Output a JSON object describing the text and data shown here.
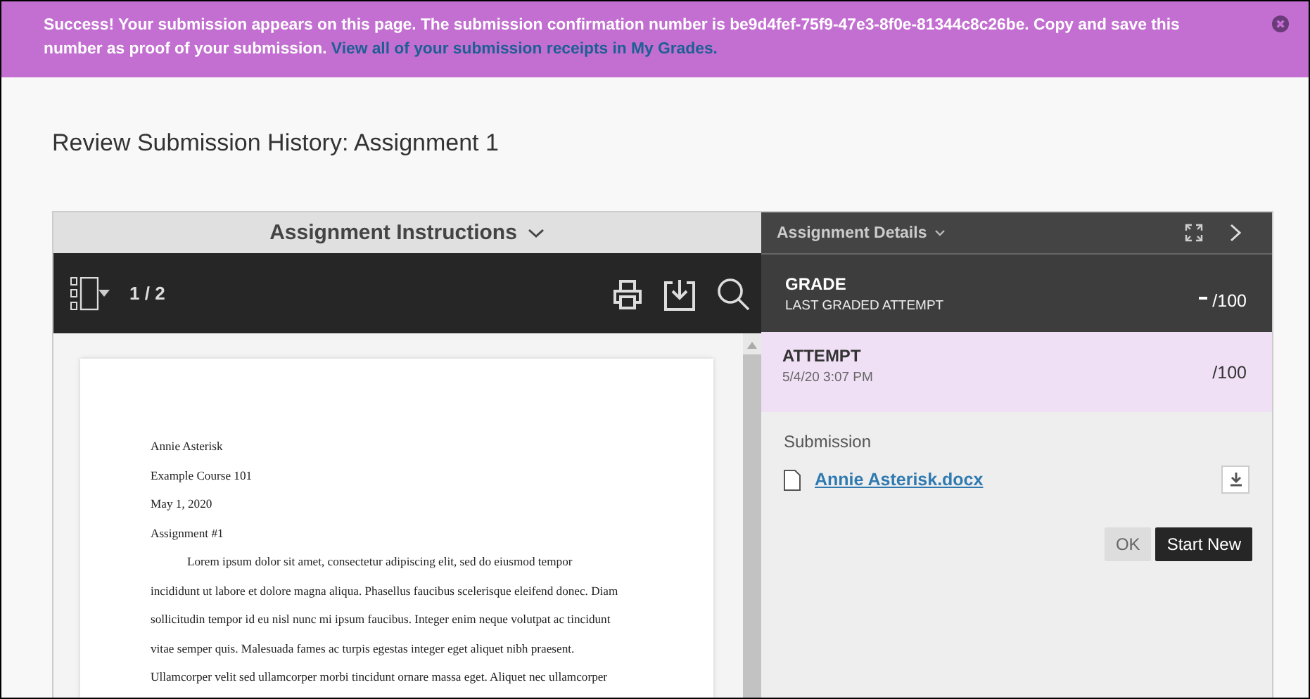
{
  "banner": {
    "text": "Success! Your submission appears on this page. The submission confirmation number is be9d4fef-75f9-47e3-8f0e-81344c8c26be. Copy and save this number as proof of your submission.",
    "link": "View all of your submission receipts in My Grades."
  },
  "page_title": "Review Submission History: Assignment 1",
  "instructions": {
    "title": "Assignment Instructions",
    "page": "1 / 2",
    "document": {
      "header_lines": [
        "Annie Asterisk",
        "Example Course 101",
        "May 1, 2020",
        "Assignment #1"
      ],
      "paragraph_lines": [
        "Lorem ipsum dolor sit amet, consectetur adipiscing elit, sed do eiusmod tempor",
        "incididunt ut labore et dolore magna aliqua. Phasellus faucibus scelerisque eleifend donec. Diam",
        "sollicitudin tempor id eu nisl nunc mi ipsum faucibus. Integer enim neque volutpat ac tincidunt",
        "vitae semper quis. Malesuada fames ac turpis egestas integer eget aliquet nibh praesent.",
        "Ullamcorper velit sed ullamcorper morbi tincidunt ornare massa eget. Aliquet nec ullamcorper"
      ]
    }
  },
  "details": {
    "title": "Assignment Details",
    "rows": [
      {
        "kind": "grade",
        "label": "GRADE",
        "sublabel": "LAST GRADED ATTEMPT",
        "score": "/100",
        "graded": false
      },
      {
        "kind": "attempt",
        "label": "ATTEMPT",
        "sublabel": "5/4/20 3:07 PM",
        "score": "/100",
        "selected": true
      }
    ],
    "submission_label": "Submission",
    "file": "Annie Asterisk.docx",
    "buttons": [
      {
        "kind": "secondary",
        "label": "OK"
      },
      {
        "kind": "primary",
        "label": "Start New"
      }
    ]
  }
}
